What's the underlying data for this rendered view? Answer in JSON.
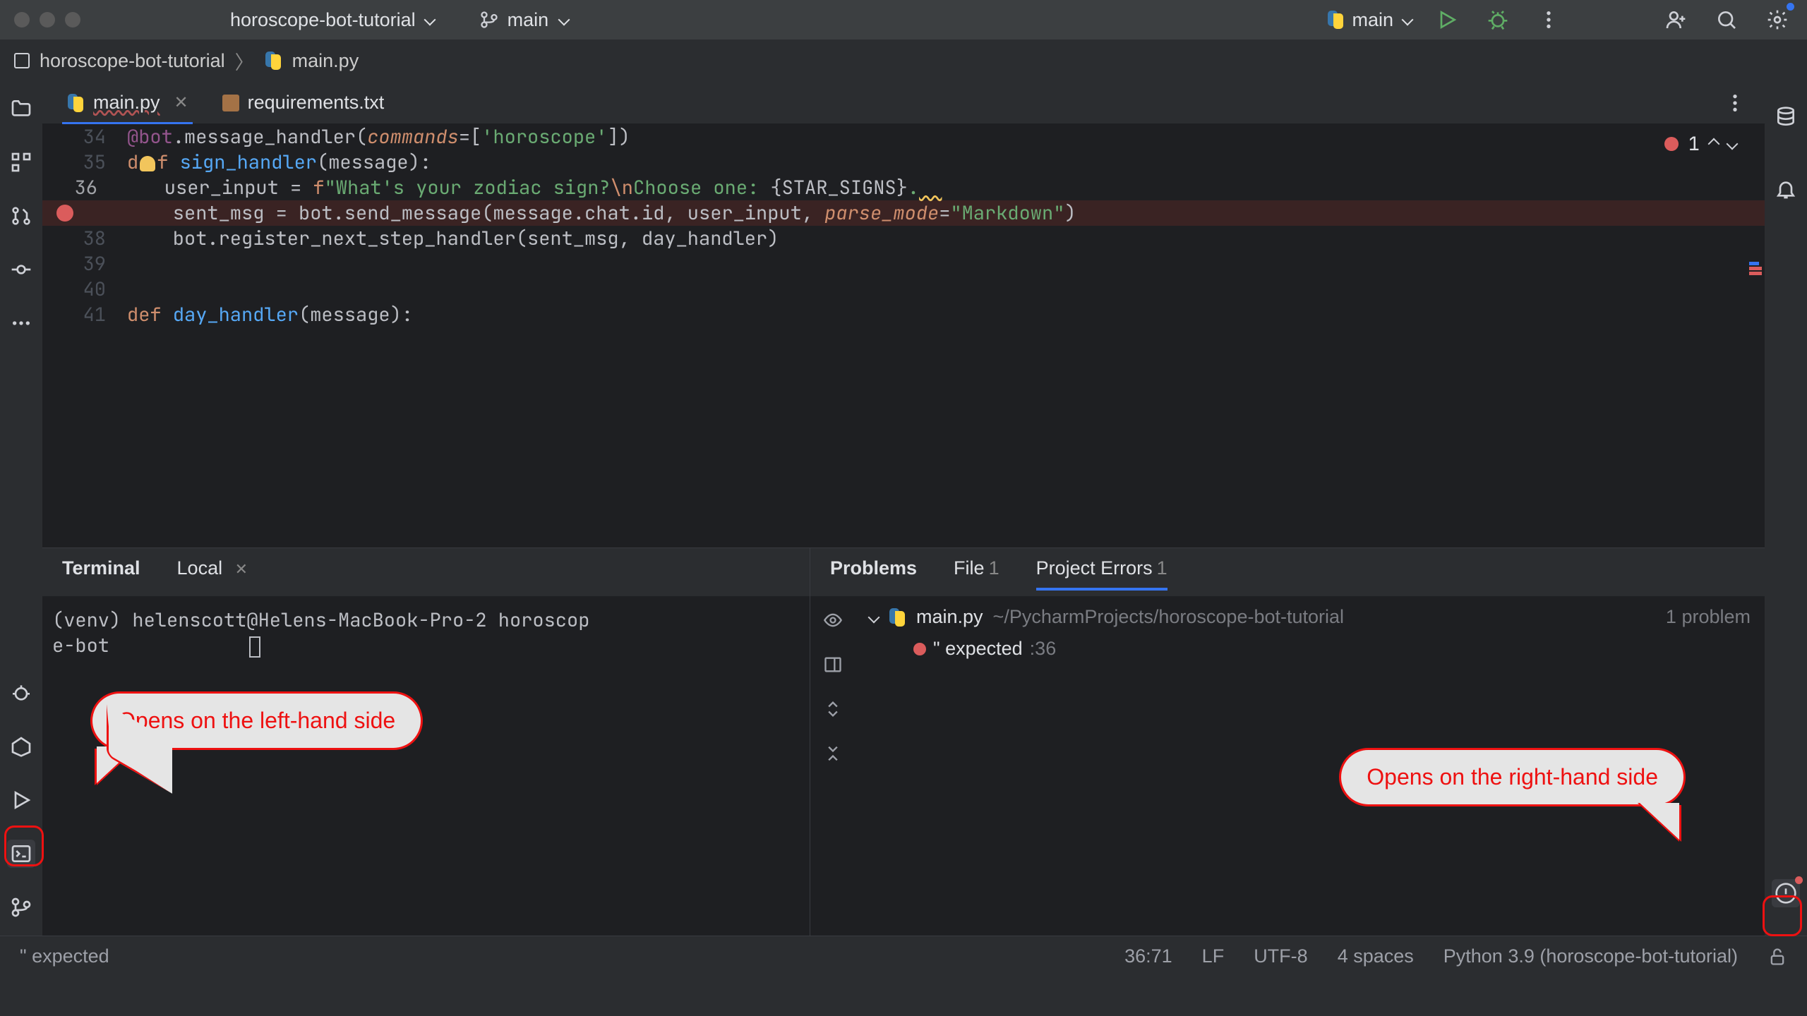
{
  "topbar": {
    "project": "horoscope-bot-tutorial",
    "branch": "main",
    "run_config": "main"
  },
  "breadcrumb": {
    "root": "horoscope-bot-tutorial",
    "file": "main.py"
  },
  "tabs": {
    "active": "main.py",
    "second": "requirements.txt"
  },
  "editor": {
    "err_count": "1",
    "lines": [
      {
        "n": "34",
        "html": "<span class='self'>@bot</span>.message_handler(<span class='param'>commands</span>=[<span class='str'>'horoscope'</span>])"
      },
      {
        "n": "35",
        "html": "<span class='kw'>d</span><span class='bulb'></span><span class='kw'>f</span> <span class='fn'>sign_handler</span>(message):"
      },
      {
        "n": "36",
        "html": "    user_input = <span class='kw'>f</span><span class='str'>\"What's your zodiac sign?</span><span class='kw'>\\n</span><span class='str'>Choose one: </span>{STAR_SIGNS}<span class='str'>.</span><span class='wave'>  </span>",
        "hl": true
      },
      {
        "n": "",
        "html": "    sent_msg = bot.send_message(message.chat.id, user_input, <span class='param'>parse_mode</span>=<span class='str'>\"Markdown\"</span>)",
        "bp": true
      },
      {
        "n": "38",
        "html": "    bot.register_next_step_handler(sent_msg, day_handler)"
      },
      {
        "n": "39",
        "html": ""
      },
      {
        "n": "40",
        "html": ""
      },
      {
        "n": "41",
        "html": "<span class='kw'>def</span> <span class='fn'>day_handler</span>(message):"
      }
    ]
  },
  "terminal": {
    "title": "Terminal",
    "tab": "Local",
    "line1": "(venv) helenscott@Helens-MacBook-Pro-2 horoscop",
    "line2": "e-bot"
  },
  "problems": {
    "title": "Problems",
    "file_tab": "File",
    "file_count": "1",
    "project_tab": "Project Errors",
    "project_count": "1",
    "file": "main.py",
    "path": "~/PycharmProjects/horoscope-bot-tutorial",
    "summary": "1 problem",
    "item": "\" expected",
    "item_line": ":36"
  },
  "statusbar": {
    "msg": "\" expected",
    "pos": "36:71",
    "sep": "LF",
    "enc": "UTF-8",
    "indent": "4 spaces",
    "interp": "Python 3.9 (horoscope-bot-tutorial)"
  },
  "callouts": {
    "left": "Opens on the left-hand side",
    "right": "Opens on the right-hand side"
  }
}
